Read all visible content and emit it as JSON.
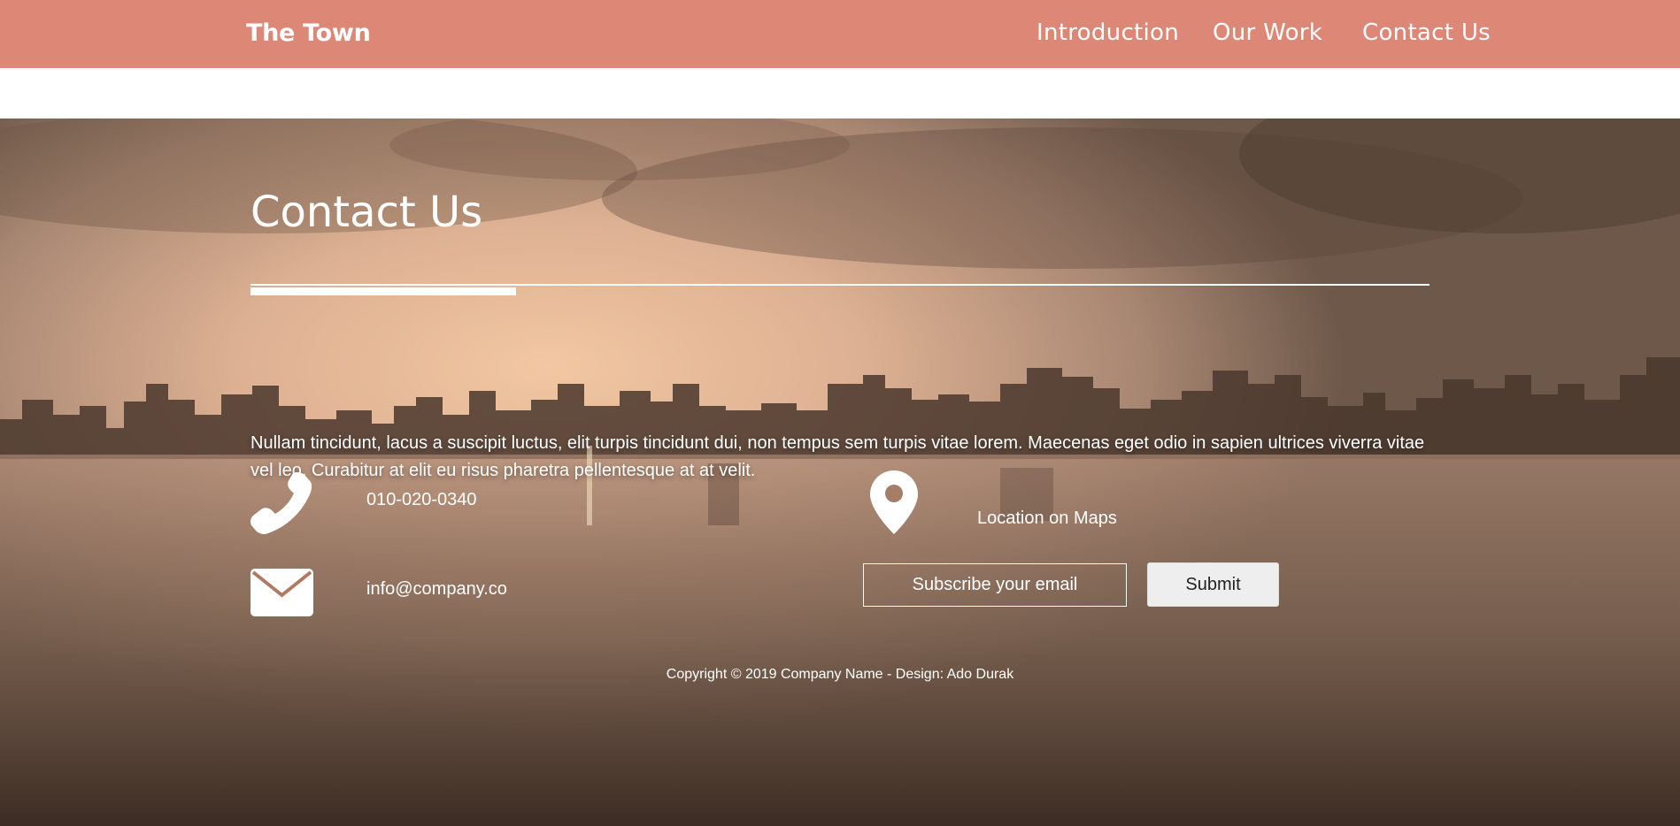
{
  "navbar": {
    "brand": "The Town",
    "links": [
      "Introduction",
      "Our Work",
      "Contact Us"
    ],
    "background_color": "#dd8877"
  },
  "contact": {
    "title": "Contact Us",
    "intro": "Nullam tincidunt, lacus a suscipit luctus, elit turpis tincidunt dui, non tempus sem turpis vitae lorem. Maecenas eget odio in sapien ultrices viverra vitae vel leo. Curabitur at elit eu risus pharetra pellentesque at at velit.",
    "phone": "010-020-0340",
    "email": "info@company.co",
    "location_label": "Location on Maps",
    "subscribe_placeholder": "Subscribe your email",
    "submit_label": "Submit",
    "icons": [
      "phone-icon",
      "envelope-icon",
      "map-pin-icon"
    ]
  },
  "footer": {
    "copyright": "Copyright © 2019 Company Name - Design: Ado Durak"
  }
}
